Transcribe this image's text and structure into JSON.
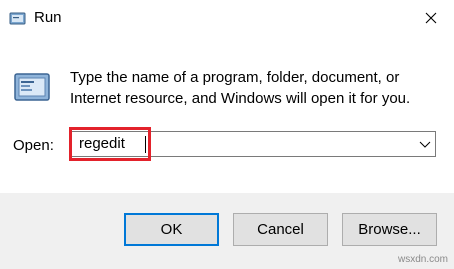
{
  "window": {
    "title": "Run",
    "title_icon": "run-icon",
    "close_icon": "close-icon"
  },
  "content": {
    "icon": "run-program-icon",
    "description": "Type the name of a program, folder, document, or Internet resource, and Windows will open it for you.",
    "open_label": "Open:",
    "input_value": "regedit",
    "dropdown_icon": "chevron-down-icon"
  },
  "buttons": {
    "ok": "OK",
    "cancel": "Cancel",
    "browse": "Browse..."
  },
  "watermark": "wsxdn.com",
  "colors": {
    "highlight": "#e3222b",
    "default_button_border": "#0078d7",
    "footer_bg": "#f0f0f0"
  }
}
